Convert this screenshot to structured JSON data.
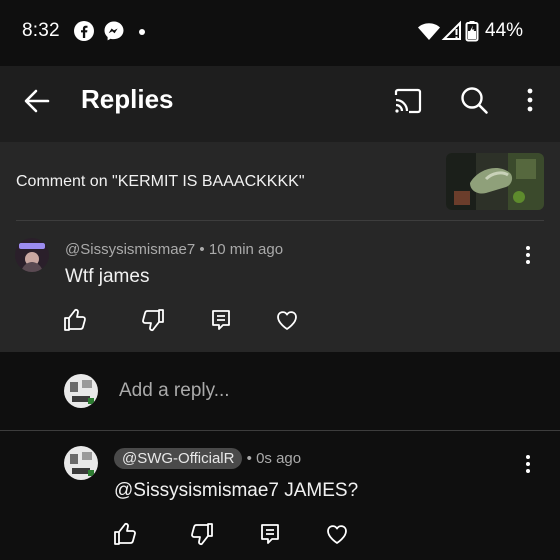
{
  "status_bar": {
    "time": "8:32",
    "battery": "44%",
    "icons": [
      "facebook-icon",
      "messenger-icon",
      "notification-dot",
      "wifi-icon",
      "signal-icon",
      "battery-icon"
    ]
  },
  "app_bar": {
    "title": "Replies",
    "icons": [
      "back-arrow-icon",
      "cast-icon",
      "search-icon",
      "more-vert-icon"
    ]
  },
  "video": {
    "comment_on_label": "Comment on \"KERMIT IS BAAACKKKK\""
  },
  "comment": {
    "author": "@Sissysismismae7",
    "time": "10 min ago",
    "separator": "•",
    "text": "Wtf james",
    "actions": [
      "like-icon",
      "dislike-icon",
      "reply-icon",
      "heart-icon"
    ]
  },
  "reply_box": {
    "placeholder": "Add a reply..."
  },
  "reply": {
    "author": "@SWG-OfficialR",
    "separator": "•",
    "time": "0s ago",
    "text": "@Sissysismismae7 JAMES?",
    "actions": [
      "like-icon",
      "dislike-icon",
      "reply-icon",
      "heart-icon"
    ]
  },
  "colors": {
    "background": "#0f0f0f",
    "panel": "#272727",
    "appbar": "#1e1e1e",
    "secondary_text": "#aaaaaa",
    "author_chip": "#4a4a4a"
  }
}
